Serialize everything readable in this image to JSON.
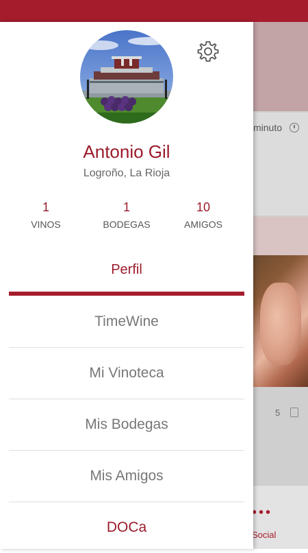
{
  "profile": {
    "name": "Antonio Gil",
    "location": "Logroño, La Rioja"
  },
  "stats": [
    {
      "value": "1",
      "label": "VINOS"
    },
    {
      "value": "1",
      "label": "BODEGAS"
    },
    {
      "value": "10",
      "label": "AMIGOS"
    }
  ],
  "tabs": {
    "active": "Perfil"
  },
  "menu": [
    {
      "label": "TimeWine"
    },
    {
      "label": "Mi Vinoteca"
    },
    {
      "label": "Mis Bodegas"
    },
    {
      "label": "Mis Amigos"
    },
    {
      "label": "DOCa"
    }
  ],
  "background": {
    "time_text": "minuto",
    "likes_count": "5",
    "bottom_label": "Social"
  },
  "colors": {
    "accent": "#a51d2d",
    "text_muted": "#777777"
  },
  "icons": {
    "settings": "gear-icon"
  }
}
